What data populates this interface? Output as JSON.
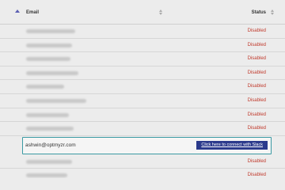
{
  "table": {
    "columns": {
      "email": "Email",
      "status": "Status"
    },
    "rows_before": [
      {
        "status": "Disabled"
      },
      {
        "status": "Disabled"
      },
      {
        "status": "Disabled"
      },
      {
        "status": "Disabled"
      },
      {
        "status": "Disabled"
      },
      {
        "status": "Disabled"
      },
      {
        "status": "Disabled"
      },
      {
        "status": "Disabled"
      }
    ],
    "highlighted_row": {
      "email": "ashwin@optmyzr.com",
      "button_label": "Click here to connect with Slack"
    },
    "rows_after": [
      {
        "status": "Disabled"
      },
      {
        "status": "Disabled"
      }
    ]
  },
  "colors": {
    "status_disabled": "#c0392b",
    "connect_button": "#2b3a8c",
    "highlight_border": "#3a9aa3"
  }
}
